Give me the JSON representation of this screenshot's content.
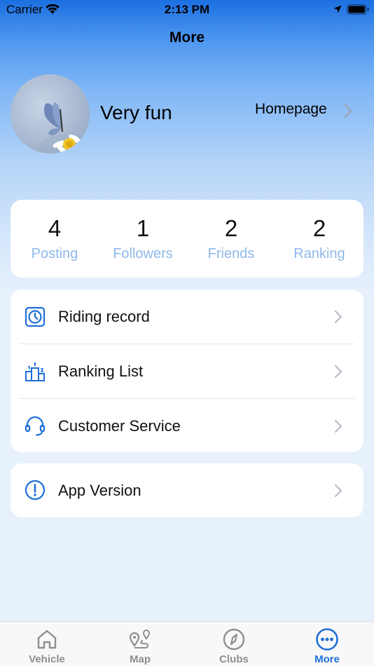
{
  "status_bar": {
    "carrier": "Carrier",
    "time": "2:13 PM"
  },
  "nav": {
    "title": "More"
  },
  "profile": {
    "name": "Very fun",
    "homepage_label": "Homepage"
  },
  "stats": [
    {
      "value": "4",
      "label": "Posting"
    },
    {
      "value": "1",
      "label": "Followers"
    },
    {
      "value": "2",
      "label": "Friends"
    },
    {
      "value": "2",
      "label": "Ranking"
    }
  ],
  "menu": [
    {
      "label": "Riding record",
      "icon": "clock-icon"
    },
    {
      "label": "Ranking List",
      "icon": "podium-icon"
    },
    {
      "label": "Customer Service",
      "icon": "headset-icon"
    }
  ],
  "version": {
    "label": "App Version",
    "icon": "exclamation-circle-icon"
  },
  "tabs": [
    {
      "label": "Vehicle",
      "icon": "home-icon",
      "active": false
    },
    {
      "label": "Map",
      "icon": "map-route-icon",
      "active": false
    },
    {
      "label": "Clubs",
      "icon": "compass-icon",
      "active": false
    },
    {
      "label": "More",
      "icon": "more-dots-icon",
      "active": true
    }
  ],
  "colors": {
    "accent": "#1e6fd9",
    "stat_label": "#8fb8ea",
    "header_top": "#1b6fe0"
  }
}
